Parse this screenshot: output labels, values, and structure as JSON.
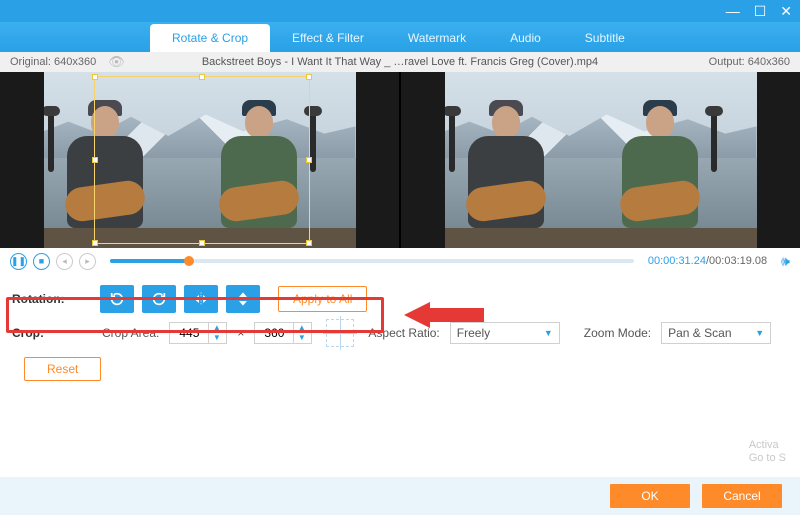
{
  "titlebar": {
    "minimize": "—",
    "maximize": "☐",
    "close": "✕"
  },
  "tabs": [
    {
      "label": "Rotate & Crop",
      "active": true
    },
    {
      "label": "Effect & Filter"
    },
    {
      "label": "Watermark"
    },
    {
      "label": "Audio"
    },
    {
      "label": "Subtitle"
    }
  ],
  "infobar": {
    "original_label": "Original: 640x360",
    "filename": "Backstreet Boys - I Want It That Way _ …ravel Love ft. Francis Greg (Cover).mp4",
    "output_label": "Output: 640x360"
  },
  "playbar": {
    "current": "00:00:31.24",
    "separator": "/",
    "total": "00:03:19.08",
    "progress_percent": 15
  },
  "rotation": {
    "label": "Rotation:",
    "apply_all": "Apply to All",
    "buttons": [
      "rotate-left",
      "rotate-right",
      "flip-horizontal",
      "flip-vertical"
    ]
  },
  "crop": {
    "label": "Crop:",
    "area_label": "Crop Area:",
    "w": "445",
    "mult": "×",
    "h": "360",
    "aspect_label": "Aspect Ratio:",
    "aspect_value": "Freely",
    "zoom_label": "Zoom Mode:",
    "zoom_value": "Pan & Scan",
    "reset": "Reset"
  },
  "footer": {
    "ok": "OK",
    "cancel": "Cancel"
  },
  "watermark_hint": {
    "line1": "Activa",
    "line2": "Go to S"
  }
}
